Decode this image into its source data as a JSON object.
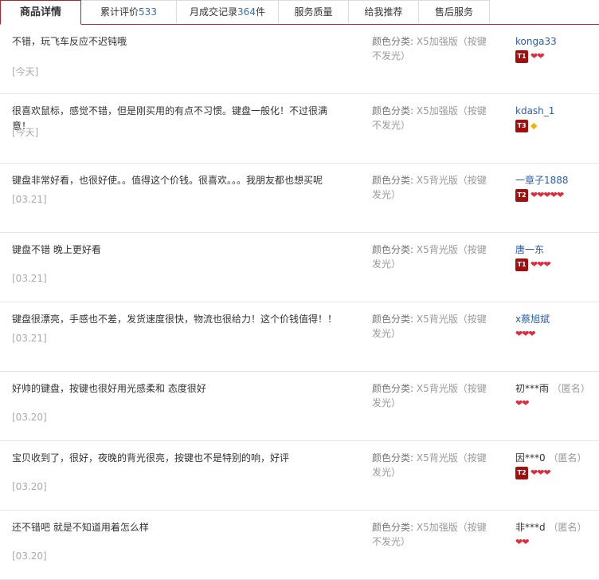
{
  "tabs": [
    {
      "label": "商品详情",
      "count": "",
      "suffix": "",
      "active": true
    },
    {
      "label": "累计评价",
      "count": "533",
      "suffix": "",
      "active": false
    },
    {
      "label": "月成交记录",
      "count": "364",
      "suffix": "件",
      "active": false
    },
    {
      "label": "服务质量",
      "count": "",
      "suffix": "",
      "active": false
    },
    {
      "label": "给我推荐",
      "count": "",
      "suffix": "",
      "active": false
    },
    {
      "label": "售后服务",
      "count": "",
      "suffix": "",
      "active": false
    }
  ],
  "reviews": [
    {
      "comment": "不错，玩飞车反应不迟钝哦",
      "date": "[今天]",
      "attr_key": "颜色分类:",
      "attr_val": "X5加强版（按键不发光）",
      "user": "konga33",
      "anon": "",
      "vip": "T1",
      "hearts": "❤❤",
      "badge": "hearts"
    },
    {
      "comment": "很喜欢鼠标，感觉不错，但是刚买用的有点不习惯。键盘一般化！不过很满意！",
      "date": "[今天]",
      "attr_key": "颜色分类:",
      "attr_val": "X5加强版（按键不发光）",
      "user": "kdash_1",
      "anon": "",
      "vip": "T3",
      "hearts": "◆",
      "badge": "diamond"
    },
    {
      "comment": "键盘非常好看，也很好使。。值得这个价钱。很喜欢。。。我朋友都也想买呢",
      "date": "[03.21]",
      "attr_key": "颜色分类:",
      "attr_val": "X5背光版（按键发光）",
      "user": "一章子1888",
      "anon": "",
      "vip": "T2",
      "hearts": "❤❤❤❤❤",
      "badge": "hearts"
    },
    {
      "comment": "键盘不错 晚上更好看",
      "date": "[03.21]",
      "attr_key": "颜色分类:",
      "attr_val": "X5背光版（按键发光）",
      "user": "唐一东",
      "anon": "",
      "vip": "T1",
      "hearts": "❤❤❤",
      "badge": "hearts"
    },
    {
      "comment": "键盘很漂亮，手感也不差，发货速度很快，物流也很给力！这个价钱值得！！",
      "date": "[03.21]",
      "attr_key": "颜色分类:",
      "attr_val": "X5背光版（按键发光）",
      "user": "x蔡旭斌",
      "anon": "",
      "vip": "",
      "hearts": "❤❤❤",
      "badge": "hearts"
    },
    {
      "comment": "好帅的键盘，按键也很好用光感柔和 态度很好",
      "date": "[03.20]",
      "attr_key": "颜色分类:",
      "attr_val": "X5背光版（按键发光）",
      "user": "初***雨",
      "anon": "（匿名）",
      "vip": "",
      "hearts": "❤❤",
      "badge": "hearts"
    },
    {
      "comment": "宝贝收到了，很好，夜晚的背光很亮，按键也不是特别的响，好评",
      "date": "[03.20]",
      "attr_key": "颜色分类:",
      "attr_val": "X5背光版（按键发光）",
      "user": "因***0",
      "anon": "（匿名）",
      "vip": "T2",
      "hearts": "❤❤❤",
      "badge": "hearts"
    },
    {
      "comment": "还不错吧 就是不知道用着怎么样",
      "date": "[03.20]",
      "attr_key": "颜色分类:",
      "attr_val": "X5加强版（按键不发光）",
      "user": "非***d",
      "anon": "（匿名）",
      "vip": "",
      "hearts": "❤❤",
      "badge": "hearts"
    }
  ]
}
